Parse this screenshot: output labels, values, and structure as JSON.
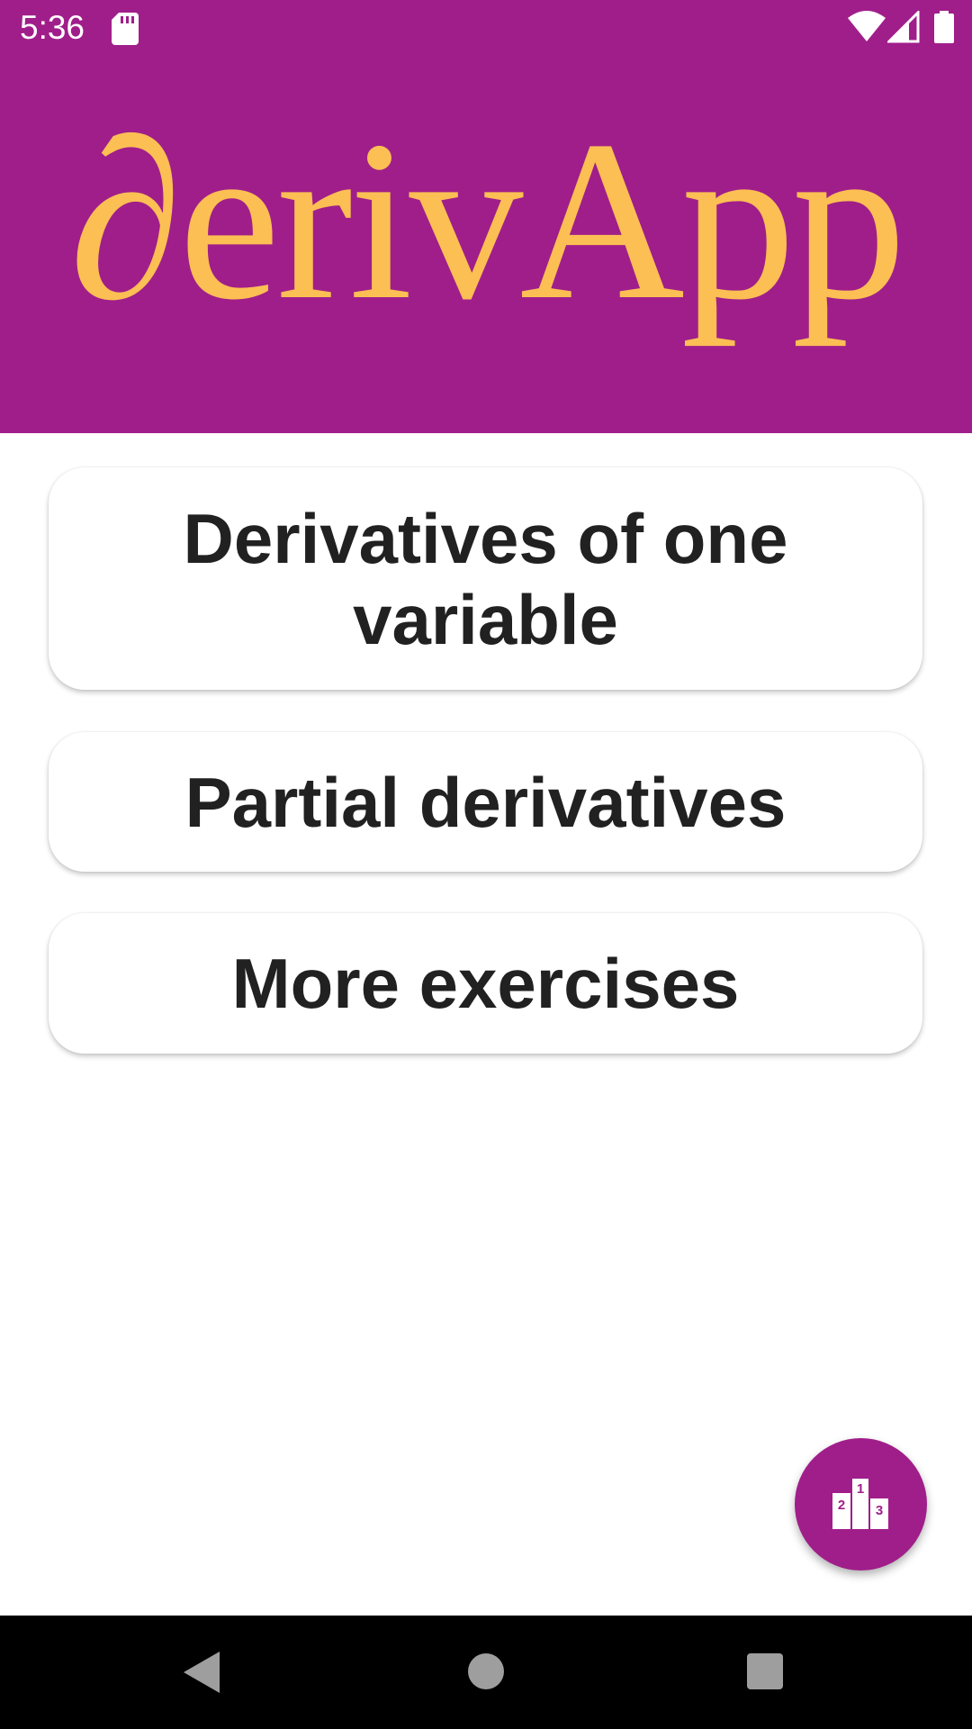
{
  "status_bar": {
    "time": "5:36",
    "icons": [
      "sd-card-icon",
      "wifi-icon",
      "cell-signal-icon",
      "battery-icon"
    ]
  },
  "header": {
    "logo_text": "∂erivApp",
    "background_color": "#a01e8a",
    "logo_color": "#fbbf54"
  },
  "menu": {
    "items": [
      {
        "label": "Derivatives of one variable"
      },
      {
        "label": "Partial derivatives"
      },
      {
        "label": "More exercises"
      }
    ]
  },
  "fab": {
    "icon": "leaderboard-podium-icon",
    "podium_labels": [
      "2",
      "1",
      "3"
    ]
  },
  "nav_bar": {
    "icons": [
      "back-icon",
      "home-icon",
      "recents-icon"
    ]
  }
}
